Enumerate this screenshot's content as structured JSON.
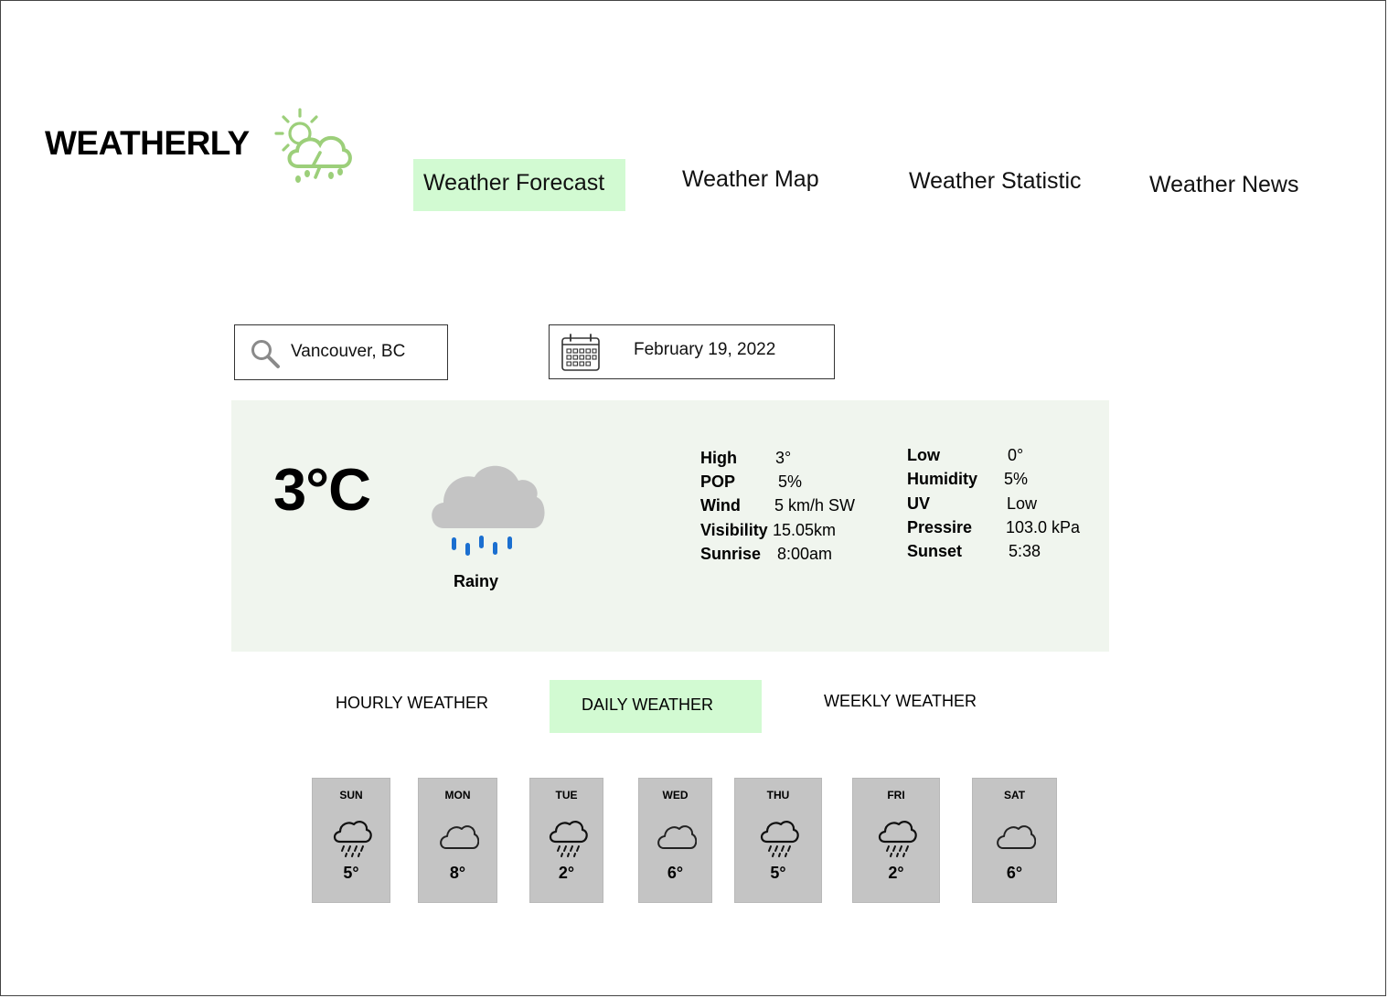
{
  "app": {
    "title": "WEATHERLY",
    "logo_icon": "sun-cloud-storm-icon",
    "accent_color": "#d2fad2",
    "logo_color": "#9ccf7a"
  },
  "nav": {
    "forecast": "Weather Forecast",
    "map": "Weather Map",
    "statistic": "Weather Statistic",
    "news": "Weather News"
  },
  "search": {
    "value": "Vancouver, BC"
  },
  "date_picker": {
    "value": "February 19, 2022"
  },
  "current": {
    "temperature": "3°C",
    "condition": "Rainy",
    "condition_icon": "rain-cloud-icon",
    "stats_left": [
      {
        "label": "High",
        "value": "3°"
      },
      {
        "label": "POP",
        "value": "5%"
      },
      {
        "label": "Wind",
        "value": "5 km/h SW"
      },
      {
        "label": "Visibility",
        "value": "15.05km"
      },
      {
        "label": "Sunrise",
        "value": "8:00am"
      }
    ],
    "stats_right": [
      {
        "label": "Low",
        "value": "0°"
      },
      {
        "label": "Humidity",
        "value": "5%"
      },
      {
        "label": "UV",
        "value": "Low"
      },
      {
        "label": "Pressire",
        "value": "103.0 kPa"
      },
      {
        "label": "Sunset",
        "value": "5:38"
      }
    ]
  },
  "tabs": {
    "hourly": "HOURLY WEATHER",
    "daily": "DAILY WEATHER",
    "weekly": "WEEKLY WEATHER",
    "active": "daily"
  },
  "days": [
    {
      "name": "SUN",
      "temp": "5°",
      "icon": "rain-icon"
    },
    {
      "name": "MON",
      "temp": "8°",
      "icon": "cloud-icon"
    },
    {
      "name": "TUE",
      "temp": "2°",
      "icon": "rain-icon"
    },
    {
      "name": "WED",
      "temp": "6°",
      "icon": "cloud-icon"
    },
    {
      "name": "THU",
      "temp": "5°",
      "icon": "rain-icon"
    },
    {
      "name": "FRI",
      "temp": "2°",
      "icon": "rain-icon"
    },
    {
      "name": "SAT",
      "temp": "6°",
      "icon": "cloud-icon"
    }
  ]
}
